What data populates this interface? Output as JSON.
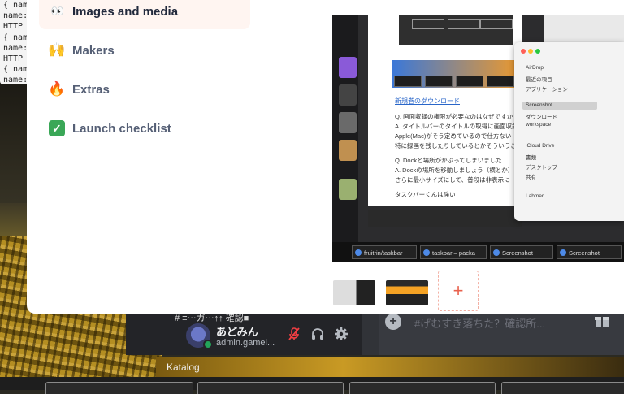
{
  "terminal": {
    "lines": [
      "{ nam",
      "name:",
      "HTTP",
      "{ nam",
      "name:",
      "HTTP",
      "{ nam",
      "name:"
    ]
  },
  "menu": {
    "items": [
      {
        "label": "Images and media",
        "icon": "eyes-icon",
        "active": true
      },
      {
        "label": "Makers",
        "icon": "raised-hands-icon"
      },
      {
        "label": "Extras",
        "icon": "fire-icon"
      },
      {
        "label": "Launch checklist",
        "icon": "check-mark-icon"
      }
    ]
  },
  "media": {
    "doc_link": "新規巻のダウンロード",
    "doc_lines": [
      "Q. 画面収録の権限が必要なのはなぜですか",
      "A. タイトルバーのタイトルの取得に画面収録",
      "Apple(Mac)がそう定めているので仕方ない",
      "特に録画を残したりしているとかそういうこと",
      "Q. Dockと場所がかぶってしまいました",
      "A. Dockの場所を移動しましょう（横とか）",
      "さらに最小サイズにして、普段は非表示に",
      "タスクバーくんは強い！"
    ],
    "taskbar_buttons": [
      "fruitrin/taskbar",
      "taskbar – packa",
      "Screenshot",
      "Screenshot"
    ],
    "finder_items": [
      "AirDrop",
      "最近の項目",
      "アプリケーション",
      "Screenshot",
      "ダウンロード",
      "workspace",
      "iCloud Drive",
      "書類",
      "デスクトップ",
      "共有",
      "Labmer"
    ]
  },
  "add_button_label": "+",
  "discord": {
    "username": "あどみん",
    "handle": "admin.gamel...",
    "channel_header": "# ≡⋯ガ⋯↑↑ 確認■",
    "chat_placeholder": "#げむすき落ちた？確認所..."
  },
  "taskbar": {
    "folder_label": "Katalog"
  }
}
